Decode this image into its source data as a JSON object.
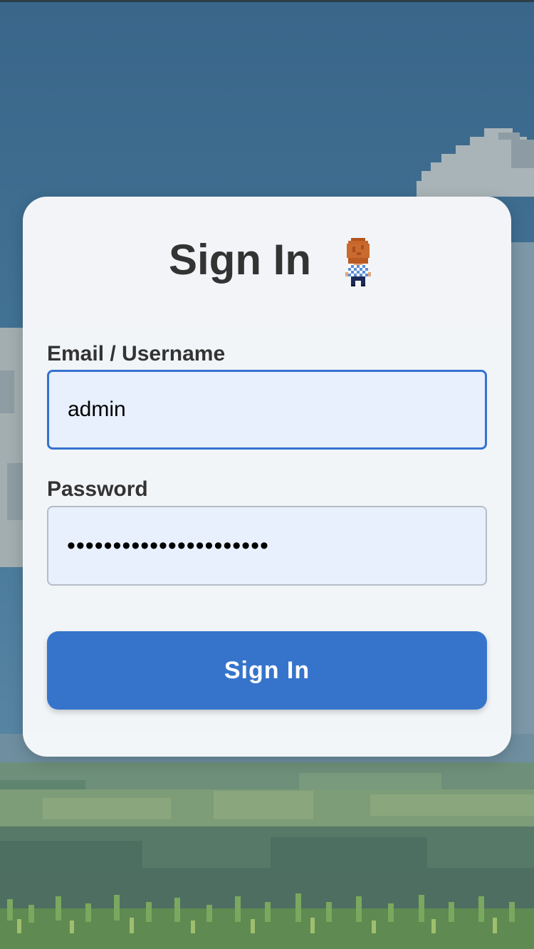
{
  "background": {
    "sky_color": "#3e6f93",
    "cloud_color": "#aab4b8",
    "hill_color": "#6f9272",
    "grass_color": "#6a9a56"
  },
  "login": {
    "title": "Sign In",
    "email_label": "Email / Username",
    "email_value": "admin",
    "password_label": "Password",
    "password_value": "••••••••••••••••••••••",
    "submit_label": "Sign In",
    "accent_color": "#3674cc"
  }
}
